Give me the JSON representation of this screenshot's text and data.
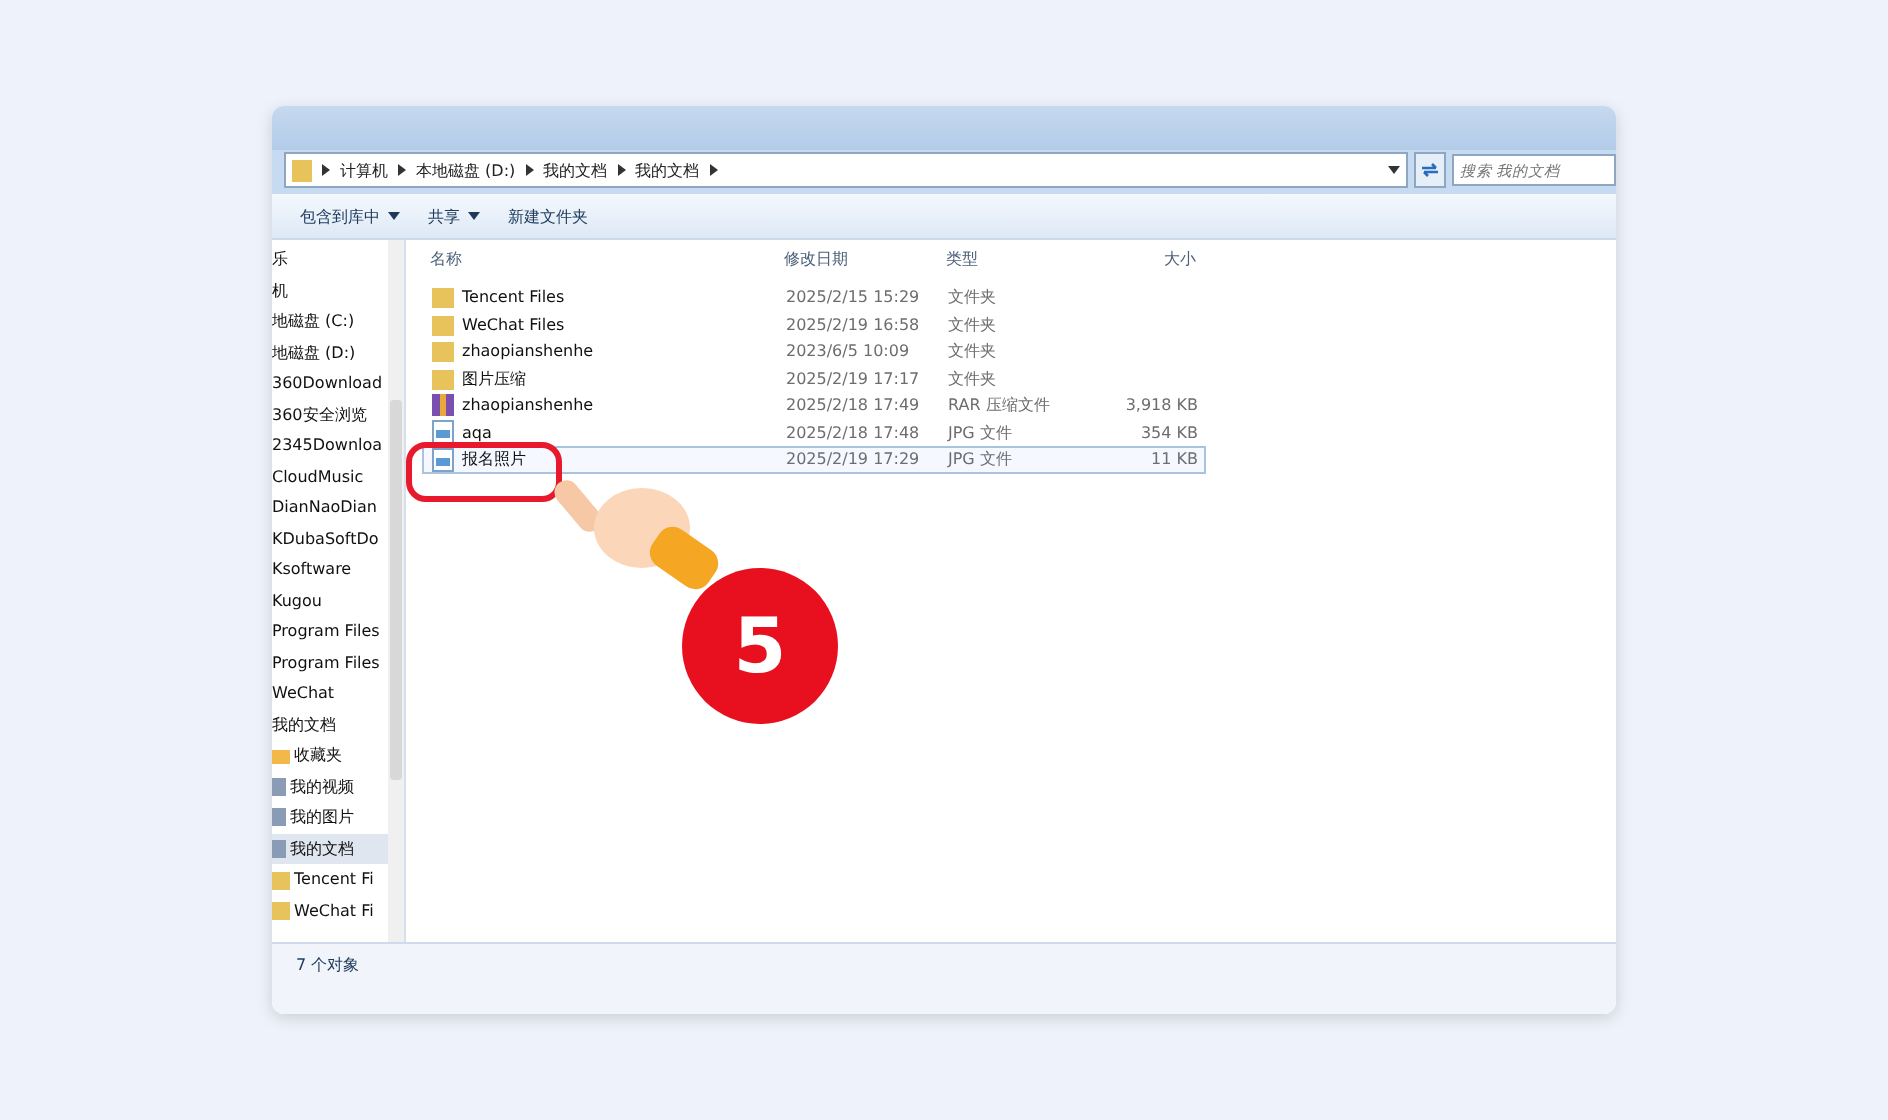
{
  "breadcrumb": [
    "计算机",
    "本地磁盘 (D:)",
    "我的文档",
    "我的文档"
  ],
  "search": {
    "placeholder": "搜索 我的文档"
  },
  "toolbar": [
    {
      "label": "包含到库中",
      "dropdown": true
    },
    {
      "label": "共享",
      "dropdown": true
    },
    {
      "label": "新建文件夹",
      "dropdown": false
    }
  ],
  "sidebar": {
    "items": [
      {
        "label": "乐",
        "kind": "plain",
        "selected": false
      },
      {
        "label": "机",
        "kind": "plain",
        "selected": false
      },
      {
        "label": "地磁盘 (C:)",
        "kind": "plain",
        "selected": false
      },
      {
        "label": "地磁盘 (D:)",
        "kind": "plain",
        "selected": false
      },
      {
        "label": "360Download",
        "kind": "plain",
        "selected": false
      },
      {
        "label": "360安全浏览",
        "kind": "plain",
        "selected": false
      },
      {
        "label": "2345Downloa",
        "kind": "plain",
        "selected": false
      },
      {
        "label": "CloudMusic",
        "kind": "plain",
        "selected": false
      },
      {
        "label": "DianNaoDian",
        "kind": "plain",
        "selected": false
      },
      {
        "label": "KDubaSoftDo",
        "kind": "plain",
        "selected": false
      },
      {
        "label": "Ksoftware",
        "kind": "plain",
        "selected": false
      },
      {
        "label": "Kugou",
        "kind": "plain",
        "selected": false
      },
      {
        "label": "Program Files",
        "kind": "plain",
        "selected": false
      },
      {
        "label": "Program Files",
        "kind": "plain",
        "selected": false
      },
      {
        "label": "WeChat",
        "kind": "plain",
        "selected": false
      },
      {
        "label": "我的文档",
        "kind": "plain",
        "selected": false
      },
      {
        "label": "收藏夹",
        "kind": "star",
        "selected": false
      },
      {
        "label": "我的视频",
        "kind": "doc",
        "selected": false
      },
      {
        "label": "我的图片",
        "kind": "doc",
        "selected": false
      },
      {
        "label": "我的文档",
        "kind": "doc",
        "selected": true
      },
      {
        "label": "Tencent Fi",
        "kind": "folder",
        "selected": false
      },
      {
        "label": "WeChat Fi",
        "kind": "folder",
        "selected": false
      }
    ]
  },
  "table": {
    "columns": [
      "名称",
      "修改日期",
      "类型",
      "大小"
    ],
    "rows": [
      {
        "name": "Tencent Files",
        "kind": "folder",
        "date": "2025/2/15 15:29",
        "type": "文件夹",
        "size": "",
        "selected": false
      },
      {
        "name": "WeChat Files",
        "kind": "folder",
        "date": "2025/2/19 16:58",
        "type": "文件夹",
        "size": "",
        "selected": false
      },
      {
        "name": "zhaopianshenhe",
        "kind": "folder",
        "date": "2023/6/5 10:09",
        "type": "文件夹",
        "size": "",
        "selected": false
      },
      {
        "name": "图片压缩",
        "kind": "folder",
        "date": "2025/2/19 17:17",
        "type": "文件夹",
        "size": "",
        "selected": false
      },
      {
        "name": "zhaopianshenhe",
        "kind": "rar",
        "date": "2025/2/18 17:49",
        "type": "RAR 压缩文件",
        "size": "3,918 KB",
        "selected": false
      },
      {
        "name": "aqa",
        "kind": "image",
        "date": "2025/2/18 17:48",
        "type": "JPG 文件",
        "size": "354 KB",
        "selected": false
      },
      {
        "name": "报名照片",
        "kind": "image",
        "date": "2025/2/19 17:29",
        "type": "JPG 文件",
        "size": "11 KB",
        "selected": true
      }
    ]
  },
  "status_bar": "7 个对象",
  "step_badge": "5"
}
